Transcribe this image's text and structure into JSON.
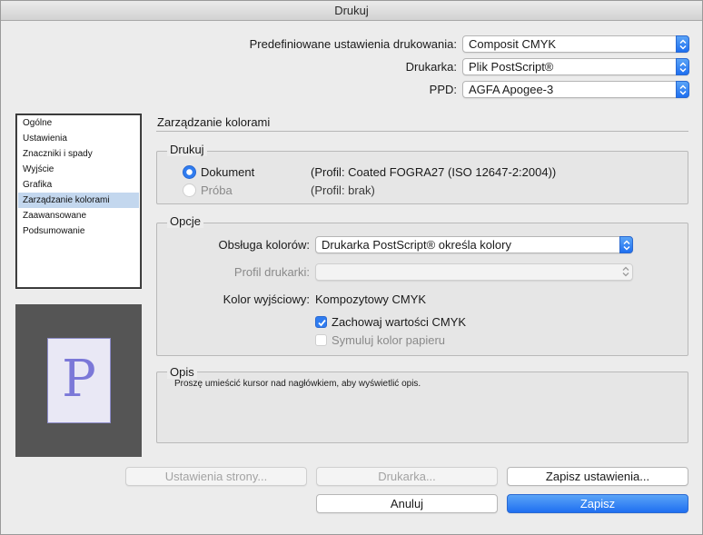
{
  "window": {
    "title": "Drukuj"
  },
  "top": {
    "preset_label": "Predefiniowane ustawienia drukowania:",
    "preset_value": "Composit CMYK",
    "printer_label": "Drukarka:",
    "printer_value": "Plik PostScript®",
    "ppd_label": "PPD:",
    "ppd_value": "AGFA Apogee-3"
  },
  "sidebar": {
    "items": [
      {
        "label": "Ogólne"
      },
      {
        "label": "Ustawienia"
      },
      {
        "label": "Znaczniki i spady"
      },
      {
        "label": "Wyjście"
      },
      {
        "label": "Grafika"
      },
      {
        "label": "Zarządzanie kolorami"
      },
      {
        "label": "Zaawansowane"
      },
      {
        "label": "Podsumowanie"
      }
    ],
    "selected_index": 5
  },
  "preview": {
    "letter": "P"
  },
  "main": {
    "title": "Zarządzanie kolorami",
    "print_group": {
      "title": "Drukuj",
      "document_label": "Dokument",
      "document_profile": "(Profil: Coated FOGRA27 (ISO 12647-2:2004))",
      "proof_label": "Próba",
      "proof_profile": "(Profil: brak)"
    },
    "options_group": {
      "title": "Opcje",
      "color_handling_label": "Obsługa kolorów:",
      "color_handling_value": "Drukarka PostScript® określa kolory",
      "printer_profile_label": "Profil drukarki:",
      "printer_profile_value": "",
      "output_color_label": "Kolor wyjściowy:",
      "output_color_value": "Kompozytowy CMYK",
      "preserve_cmyk_label": "Zachowaj wartości CMYK",
      "simulate_paper_label": "Symuluj kolor papieru"
    },
    "description_group": {
      "title": "Opis",
      "text": "Proszę umieścić kursor nad nagłówkiem, aby wyświetlić opis."
    }
  },
  "buttons": {
    "page_setup": "Ustawienia strony...",
    "printer": "Drukarka...",
    "save_settings": "Zapisz ustawienia...",
    "cancel": "Anuluj",
    "save": "Zapisz"
  },
  "colors": {
    "accent": "#2f7cf0",
    "selection": "#c3d7ee"
  }
}
